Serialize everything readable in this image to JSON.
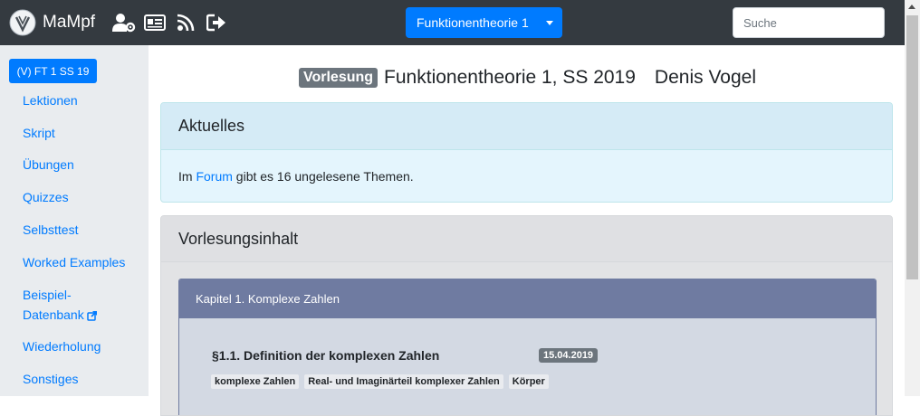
{
  "navbar": {
    "brand": "MaMpf",
    "icons": [
      "user-gear-icon",
      "id-card-icon",
      "feed-icon",
      "sign-out-icon"
    ],
    "course_select": "Funktionentheorie 1",
    "search_placeholder": "Suche"
  },
  "sidebar": {
    "active": "(V) FT 1 SS 19",
    "items": [
      {
        "label": "Lektionen"
      },
      {
        "label": "Skript"
      },
      {
        "label": "Übungen"
      },
      {
        "label": "Quizzes"
      },
      {
        "label": "Selbsttest"
      },
      {
        "label": "Worked Examples"
      },
      {
        "label": "Beispiel-",
        "label2": "Datenbank",
        "external": true
      },
      {
        "label": "Wiederholung"
      },
      {
        "label": "Sonstiges"
      }
    ]
  },
  "header": {
    "badge": "Vorlesung",
    "course": "Funktionentheorie 1, SS 2019",
    "lecturer": "Denis Vogel"
  },
  "news": {
    "title": "Aktuelles",
    "text_before": "Im ",
    "link": "Forum",
    "text_after": " gibt es 16 ungelesene Themen."
  },
  "content": {
    "title": "Vorlesungsinhalt",
    "chapter": {
      "title": "Kapitel 1. Komplexe Zahlen",
      "section": {
        "title": "§1.1. Definition der komplexen Zahlen",
        "date": "15.04.2019",
        "tags": [
          "komplexe Zahlen",
          "Real- und Imaginärteil komplexer Zahlen",
          "Körper"
        ]
      }
    }
  },
  "colors": {
    "navbar": "#343a40",
    "primary": "#007bff",
    "sidebar": "#e9ecef",
    "chapter_header": "#6f7ba1"
  }
}
